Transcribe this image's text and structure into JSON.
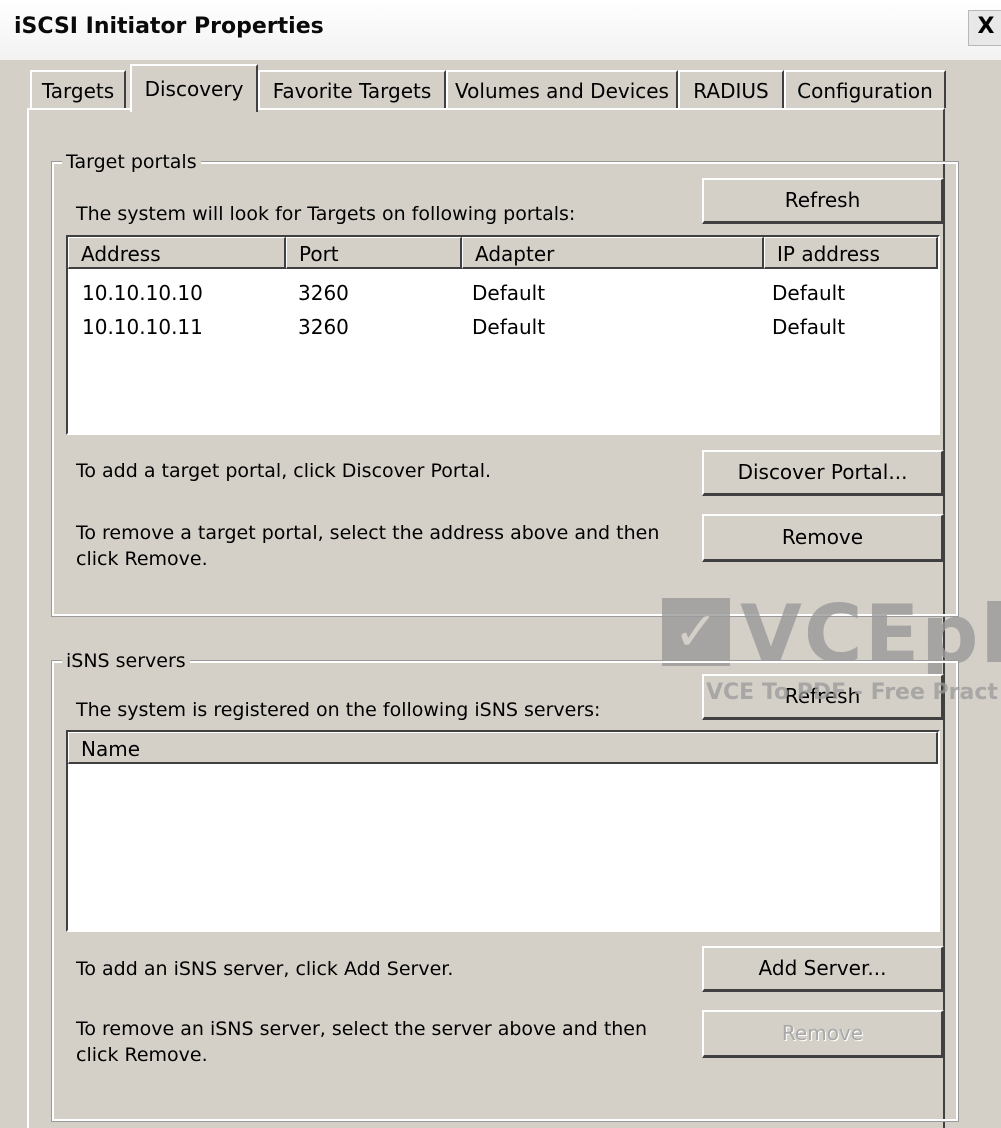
{
  "window": {
    "title": "iSCSI Initiator Properties",
    "close_label": "X"
  },
  "tabs": [
    {
      "label": "Targets",
      "active": false
    },
    {
      "label": "Discovery",
      "active": true
    },
    {
      "label": "Favorite Targets",
      "active": false
    },
    {
      "label": "Volumes and Devices",
      "active": false
    },
    {
      "label": "RADIUS",
      "active": false
    },
    {
      "label": "Configuration",
      "active": false
    }
  ],
  "target_portals": {
    "group_label": "Target portals",
    "refresh_label": "Refresh",
    "description": "The system will look for Targets on following portals:",
    "columns": [
      "Address",
      "Port",
      "Adapter",
      "IP address"
    ],
    "rows": [
      [
        "10.10.10.10",
        "3260",
        "Default",
        "Default"
      ],
      [
        "10.10.10.11",
        "3260",
        "Default",
        "Default"
      ]
    ],
    "add_text": "To add a target portal, click Discover Portal.",
    "discover_label": "Discover Portal...",
    "remove_text": "To remove a target portal, select the address above and then click Remove.",
    "remove_label": "Remove"
  },
  "isns_servers": {
    "group_label": "iSNS servers",
    "refresh_label": "Refresh",
    "description": "The system is registered on the following iSNS servers:",
    "columns": [
      "Name"
    ],
    "add_text": "To add an iSNS server, click Add Server.",
    "add_label": "Add Server...",
    "remove_text": "To remove an iSNS server, select the server above and then click Remove.",
    "remove_label": "Remove",
    "remove_disabled": true
  },
  "watermark": {
    "logo_mark": "✓",
    "brand": "VCEpl",
    "tagline": "VCE To PDF - Free Pract"
  }
}
